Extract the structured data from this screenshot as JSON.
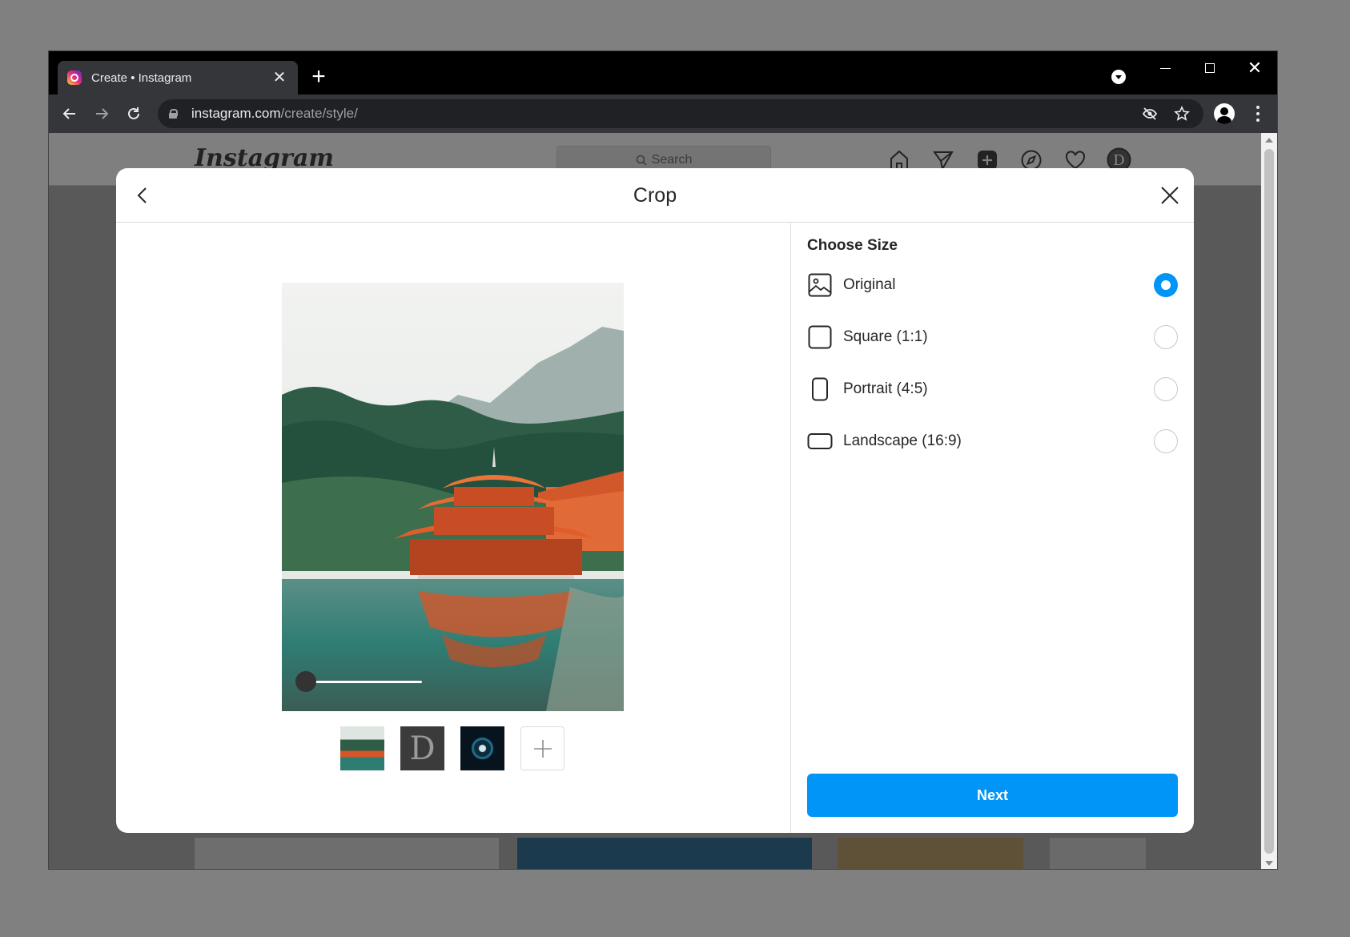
{
  "browser": {
    "tab_title": "Create • Instagram",
    "url_host": "instagram.com",
    "url_path": "/create/style/"
  },
  "instagram": {
    "logo": "Instagram",
    "search_placeholder": "Search",
    "nav_icons": [
      "home-icon",
      "direct-icon",
      "new-post-icon",
      "explore-icon",
      "activity-icon",
      "profile-avatar"
    ]
  },
  "modal": {
    "title": "Crop",
    "section_title": "Choose Size",
    "options": [
      {
        "label": "Original",
        "icon": "image-icon",
        "selected": true
      },
      {
        "label": "Square (1:1)",
        "icon": "square-icon",
        "selected": false
      },
      {
        "label": "Portrait (4:5)",
        "icon": "portrait-icon",
        "selected": false
      },
      {
        "label": "Landscape (16:9)",
        "icon": "landscape-icon",
        "selected": false
      }
    ],
    "next_label": "Next",
    "zoom_level": 0,
    "thumbnails": [
      "pagoda-lake",
      "letter-d",
      "eye-closeup"
    ],
    "accent_color": "#0095f6"
  }
}
